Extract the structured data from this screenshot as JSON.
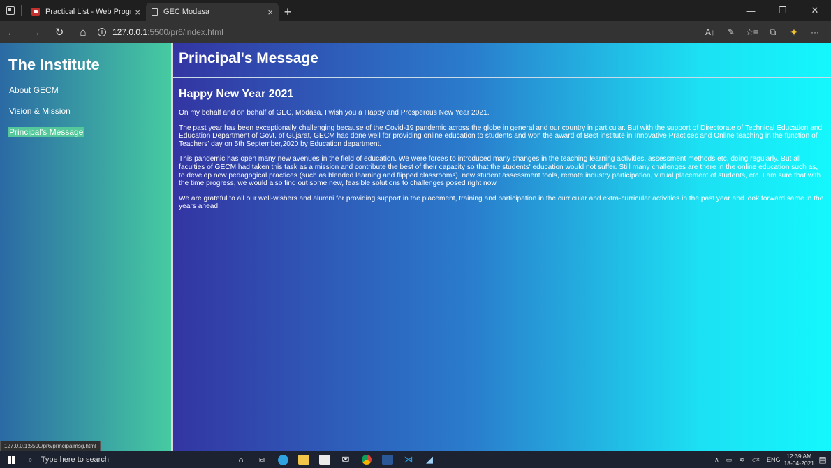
{
  "browser": {
    "tabs": [
      {
        "title": "Practical List - Web Programming",
        "close": "×"
      },
      {
        "title": "GEC Modasa",
        "close": "×"
      }
    ],
    "new_tab": "+",
    "window_controls": {
      "minimize": "—",
      "maximize": "❐",
      "close": "✕"
    },
    "nav": {
      "back": "←",
      "forward": "→",
      "refresh": "↻",
      "home": "⌂"
    },
    "url_host": "127.0.0.1",
    "url_path": ":5500/pr6/index.html",
    "status_url": "127.0.0.1:5500/pr6/principalmsg.html",
    "icons": [
      "read-aloud-icon",
      "pen-icon",
      "favorites-icon",
      "collections-icon",
      "extension-icon",
      "more-icon"
    ]
  },
  "sidebar": {
    "title": "The Institute",
    "links": [
      {
        "label": "About GECM"
      },
      {
        "label": "Vision & Mission"
      },
      {
        "label": "Principal's Message"
      }
    ]
  },
  "content": {
    "title": "Principal's Message",
    "subtitle": "Happy New Year 2021",
    "paragraphs": [
      "On my behalf and on behalf of GEC, Modasa, I wish you a Happy and Prosperous New Year 2021.",
      "The past year has been exceptionally challenging because of the Covid-19 pandemic across the globe in general and our country in particular. But with the support of Directorate of Technical Education and Education Department of Govt. of Gujarat, GECM has done well for providing online education to students and won the award of Best institute in Innovative Practices and Online teaching in the function of Teachers' day on 5th September,2020 by Education department.",
      "This pandemic has open many new avenues in the field of education. We were forces to introduced many changes in the teaching learning activities, assessment methods etc. doing regularly. But all faculties of GECM had taken this task as a mission and contribute the best of their capacity so that the students' education would not suffer. Still many challenges are there in the online education such as, to develop new pedagogical practices (such as blended learning and flipped classrooms), new student assessment tools, remote industry participation, virtual placement of students, etc. I am sure that with the time progress, we would also find out some new, feasible solutions to challenges posed right now.",
      "We are grateful to all our well-wishers and alumni for providing support in the placement, training and participation in the curricular and extra-curricular activities in the past year and look forward same in the years ahead."
    ]
  },
  "taskbar": {
    "search_placeholder": "Type here to search",
    "language": "ENG",
    "time": "12:39 AM",
    "date": "18-04-2021"
  }
}
